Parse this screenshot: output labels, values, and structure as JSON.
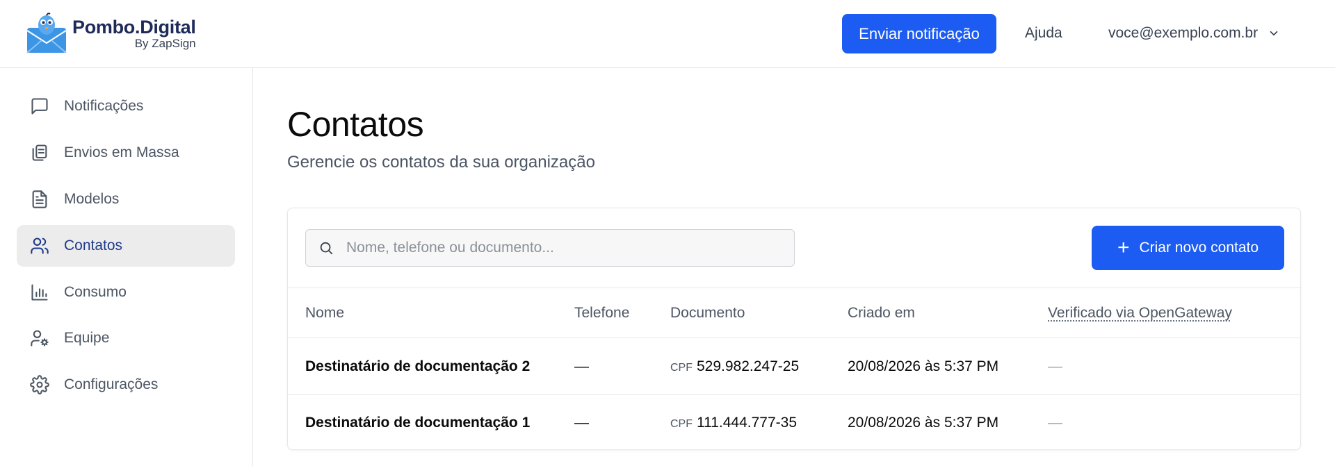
{
  "header": {
    "brand_name": "Pombo.Digital",
    "brand_sub": "By ZapSign",
    "send_button_label": "Enviar notificação",
    "help_label": "Ajuda",
    "user_email": "voce@exemplo.com.br"
  },
  "sidebar": {
    "items": [
      {
        "label": "Notificações",
        "icon": "message-square-icon",
        "active": false
      },
      {
        "label": "Envios em Massa",
        "icon": "copy-icon",
        "active": false
      },
      {
        "label": "Modelos",
        "icon": "file-text-icon",
        "active": false
      },
      {
        "label": "Contatos",
        "icon": "users-icon",
        "active": true
      },
      {
        "label": "Consumo",
        "icon": "bar-chart-icon",
        "active": false
      },
      {
        "label": "Equipe",
        "icon": "user-cog-icon",
        "active": false
      },
      {
        "label": "Configurações",
        "icon": "settings-icon",
        "active": false
      }
    ]
  },
  "main": {
    "title": "Contatos",
    "subtitle": "Gerencie os contatos da sua organização",
    "search_placeholder": "Nome, telefone ou documento...",
    "create_button_label": "Criar novo contato",
    "table": {
      "columns": [
        "Nome",
        "Telefone",
        "Documento",
        "Criado em",
        "Verificado via OpenGateway"
      ],
      "rows": [
        {
          "name": "Destinatário de documentação 2",
          "phone": "—",
          "doc_type": "CPF",
          "doc_number": "529.982.247-25",
          "created": "20/08/2026 às 5:37 PM",
          "verified": "—"
        },
        {
          "name": "Destinatário de documentação 1",
          "phone": "—",
          "doc_type": "CPF",
          "doc_number": "111.444.777-35",
          "created": "20/08/2026 às 5:37 PM",
          "verified": "—"
        }
      ]
    }
  },
  "colors": {
    "primary": "#1d5cf2",
    "active_nav_bg": "#ececec",
    "active_nav_text": "#1e3a8a",
    "brand_text": "#1e2a5a"
  }
}
